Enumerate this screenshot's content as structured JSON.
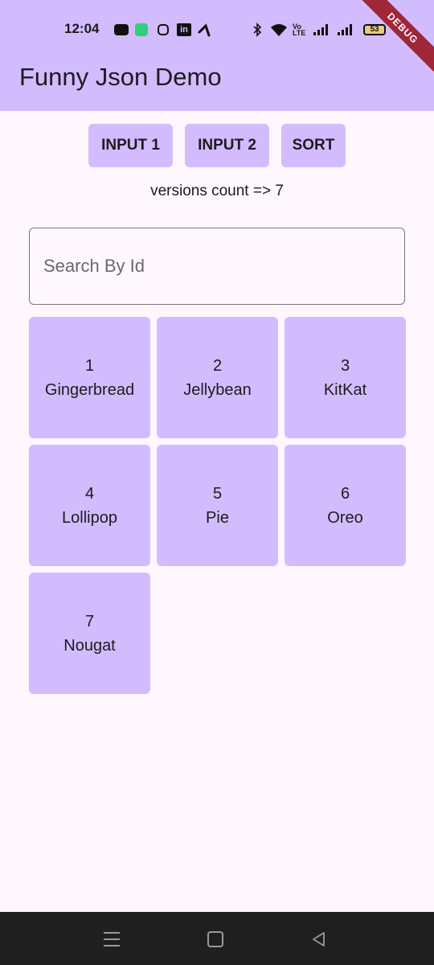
{
  "status_bar": {
    "time": "12:04",
    "battery": "53",
    "debug_banner": "DEBUG"
  },
  "app_bar": {
    "title": "Funny Json Demo"
  },
  "buttons": {
    "input1": "INPUT 1",
    "input2": "INPUT 2",
    "sort": "SORT"
  },
  "versions_count": "versions count => 7",
  "search": {
    "placeholder": "Search By Id",
    "value": ""
  },
  "versions": [
    {
      "id": "1",
      "name": "Gingerbread"
    },
    {
      "id": "2",
      "name": "Jellybean"
    },
    {
      "id": "3",
      "name": "KitKat"
    },
    {
      "id": "4",
      "name": "Lollipop"
    },
    {
      "id": "5",
      "name": "Pie"
    },
    {
      "id": "6",
      "name": "Oreo"
    },
    {
      "id": "7",
      "name": "Nougat"
    }
  ],
  "colors": {
    "accent": "#D2BCFD",
    "background": "#FFF7FE",
    "nav_bar": "#1f1f1f",
    "debug": "#a0263a"
  },
  "icons": {
    "status_left": [
      "youtube-icon",
      "app-icon",
      "instagram-icon",
      "linkedin-icon",
      "telenor-icon"
    ],
    "status_right": [
      "bluetooth-icon",
      "wifi-icon",
      "volte-icon",
      "signal-icon",
      "signal-icon",
      "battery-icon"
    ],
    "nav": [
      "recents-icon",
      "home-icon",
      "back-icon"
    ]
  }
}
